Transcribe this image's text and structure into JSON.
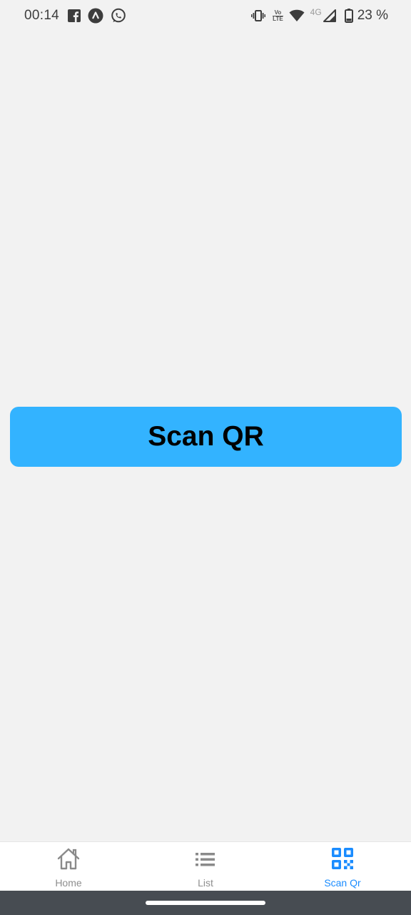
{
  "status_bar": {
    "time": "00:14",
    "left_icons": [
      "facebook-icon",
      "app-icon",
      "whatsapp-icon"
    ],
    "right_icons": [
      "vibrate-icon",
      "volte-icon",
      "wifi-icon",
      "signal-icon",
      "battery-icon"
    ],
    "volte_line1": "Vo",
    "volte_line2": "LTE",
    "network": "4G",
    "battery": "23 %"
  },
  "main": {
    "scan_button_label": "Scan QR",
    "accent_color": "#33b3ff"
  },
  "tabs": [
    {
      "label": "Home",
      "icon": "home-icon",
      "active": false
    },
    {
      "label": "List",
      "icon": "list-icon",
      "active": false
    },
    {
      "label": "Scan Qr",
      "icon": "qr-code-icon",
      "active": true
    }
  ],
  "tab_active_color": "#1a8cff"
}
